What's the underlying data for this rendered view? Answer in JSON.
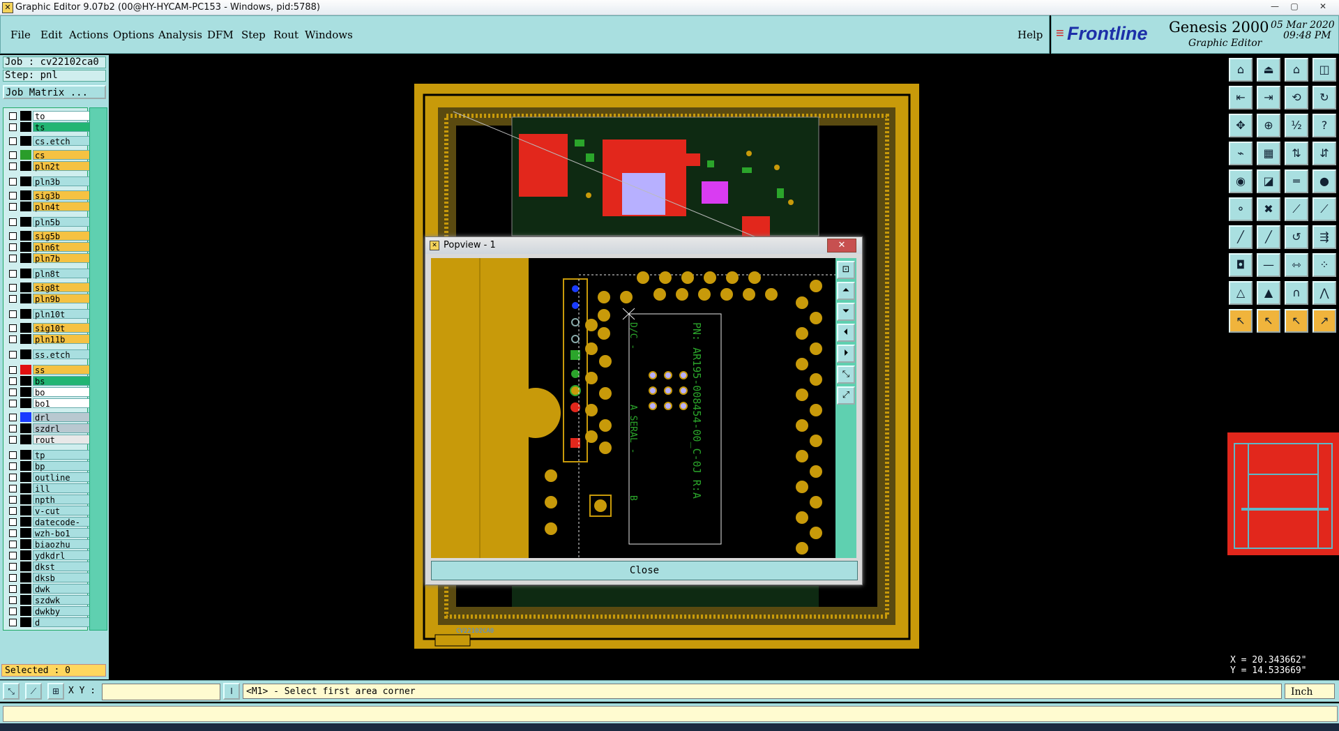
{
  "window": {
    "title": "Graphic Editor 9.07b2 (00@HY-HYCAM-PC153 - Windows, pid:5788)"
  },
  "menubar": {
    "items": [
      "File",
      "Edit",
      "Actions",
      "Options",
      "Analysis",
      "DFM",
      "Step",
      "Rout",
      "Windows"
    ],
    "help": "Help"
  },
  "brand": {
    "logo": "Frontline",
    "product": "Genesis 2000",
    "subtitle": "Graphic Editor",
    "date": "05 Mar 2020",
    "time": "09:48 PM"
  },
  "left": {
    "job": "Job : cv22102ca0",
    "step": "Step: pnl",
    "matrix_button": "Job Matrix ...",
    "selected": "Selected : 0",
    "layers": [
      {
        "name": "to",
        "bg": "#ffffff",
        "sw": "#000000"
      },
      {
        "name": "ts",
        "bg": "#22b573",
        "sw": "#000000"
      },
      {
        "name": "cs.etch",
        "bg": "#a9dfe0",
        "sw": "#000000"
      },
      {
        "name": "cs",
        "bg": "#f5c242",
        "sw": "#2a9d2a"
      },
      {
        "name": "pln2t",
        "bg": "#f5c242",
        "sw": "#000000"
      },
      {
        "name": "pln3b",
        "bg": "#a9dfe0",
        "sw": "#000000"
      },
      {
        "name": "sig3b",
        "bg": "#f5c242",
        "sw": "#000000"
      },
      {
        "name": "pln4t",
        "bg": "#f5c242",
        "sw": "#000000"
      },
      {
        "name": "pln5b",
        "bg": "#a9dfe0",
        "sw": "#000000"
      },
      {
        "name": "sig5b",
        "bg": "#f5c242",
        "sw": "#000000"
      },
      {
        "name": "pln6t",
        "bg": "#f5c242",
        "sw": "#000000"
      },
      {
        "name": "pln7b",
        "bg": "#f5c242",
        "sw": "#000000"
      },
      {
        "name": "pln8t",
        "bg": "#a9dfe0",
        "sw": "#000000"
      },
      {
        "name": "sig8t",
        "bg": "#f5c242",
        "sw": "#000000"
      },
      {
        "name": "pln9b",
        "bg": "#f5c242",
        "sw": "#000000"
      },
      {
        "name": "pln10t",
        "bg": "#a9dfe0",
        "sw": "#000000"
      },
      {
        "name": "sig10t",
        "bg": "#f5c242",
        "sw": "#000000"
      },
      {
        "name": "pln11b",
        "bg": "#f5c242",
        "sw": "#000000"
      },
      {
        "name": "ss.etch",
        "bg": "#a9dfe0",
        "sw": "#000000"
      },
      {
        "name": "ss",
        "bg": "#f5c242",
        "sw": "#e01010"
      },
      {
        "name": "bs",
        "bg": "#22b573",
        "sw": "#000000"
      },
      {
        "name": "bo",
        "bg": "#ffffff",
        "sw": "#000000"
      },
      {
        "name": "bo1",
        "bg": "#ffffff",
        "sw": "#000000"
      },
      {
        "name": "drl",
        "bg": "#b8c8d0",
        "sw": "#1a3cff"
      },
      {
        "name": "szdrl",
        "bg": "#b8c8d0",
        "sw": "#000000"
      },
      {
        "name": "rout",
        "bg": "#e8e8e8",
        "sw": "#000000"
      },
      {
        "name": "tp",
        "bg": "#a9dfe0",
        "sw": "#000000"
      },
      {
        "name": "bp",
        "bg": "#a9dfe0",
        "sw": "#000000"
      },
      {
        "name": "outline",
        "bg": "#a9dfe0",
        "sw": "#000000"
      },
      {
        "name": "ill",
        "bg": "#a9dfe0",
        "sw": "#000000"
      },
      {
        "name": "npth",
        "bg": "#a9dfe0",
        "sw": "#000000"
      },
      {
        "name": "v-cut",
        "bg": "#a9dfe0",
        "sw": "#000000"
      },
      {
        "name": "datecode-pbo",
        "bg": "#a9dfe0",
        "sw": "#000000"
      },
      {
        "name": "wzh-bo1",
        "bg": "#a9dfe0",
        "sw": "#000000"
      },
      {
        "name": "biaozhu",
        "bg": "#a9dfe0",
        "sw": "#000000"
      },
      {
        "name": "ydkdrl",
        "bg": "#a9dfe0",
        "sw": "#000000"
      },
      {
        "name": "dkst",
        "bg": "#a9dfe0",
        "sw": "#000000"
      },
      {
        "name": "dksb",
        "bg": "#a9dfe0",
        "sw": "#000000"
      },
      {
        "name": "dwk",
        "bg": "#a9dfe0",
        "sw": "#000000"
      },
      {
        "name": "szdwk",
        "bg": "#a9dfe0",
        "sw": "#000000"
      },
      {
        "name": "dwkby",
        "bg": "#a9dfe0",
        "sw": "#000000"
      },
      {
        "name": "d",
        "bg": "#a9dfe0",
        "sw": "#000000"
      }
    ]
  },
  "popview": {
    "title": "Popview - 1",
    "close_label": "Close",
    "silk_pn": "PN: AR195-008454-00_C-0J R:A",
    "silk_dc": "D/C -",
    "silk_serial": "A SERAL -",
    "silk_b": "B"
  },
  "coords": {
    "x": "X = 20.343662\"",
    "y": "Y = 14.533669\""
  },
  "status": {
    "xy_label": "X Y :",
    "prompt": "<M1> - Select first area corner",
    "unit": "Inch"
  },
  "board_label": "CV22102CA0"
}
